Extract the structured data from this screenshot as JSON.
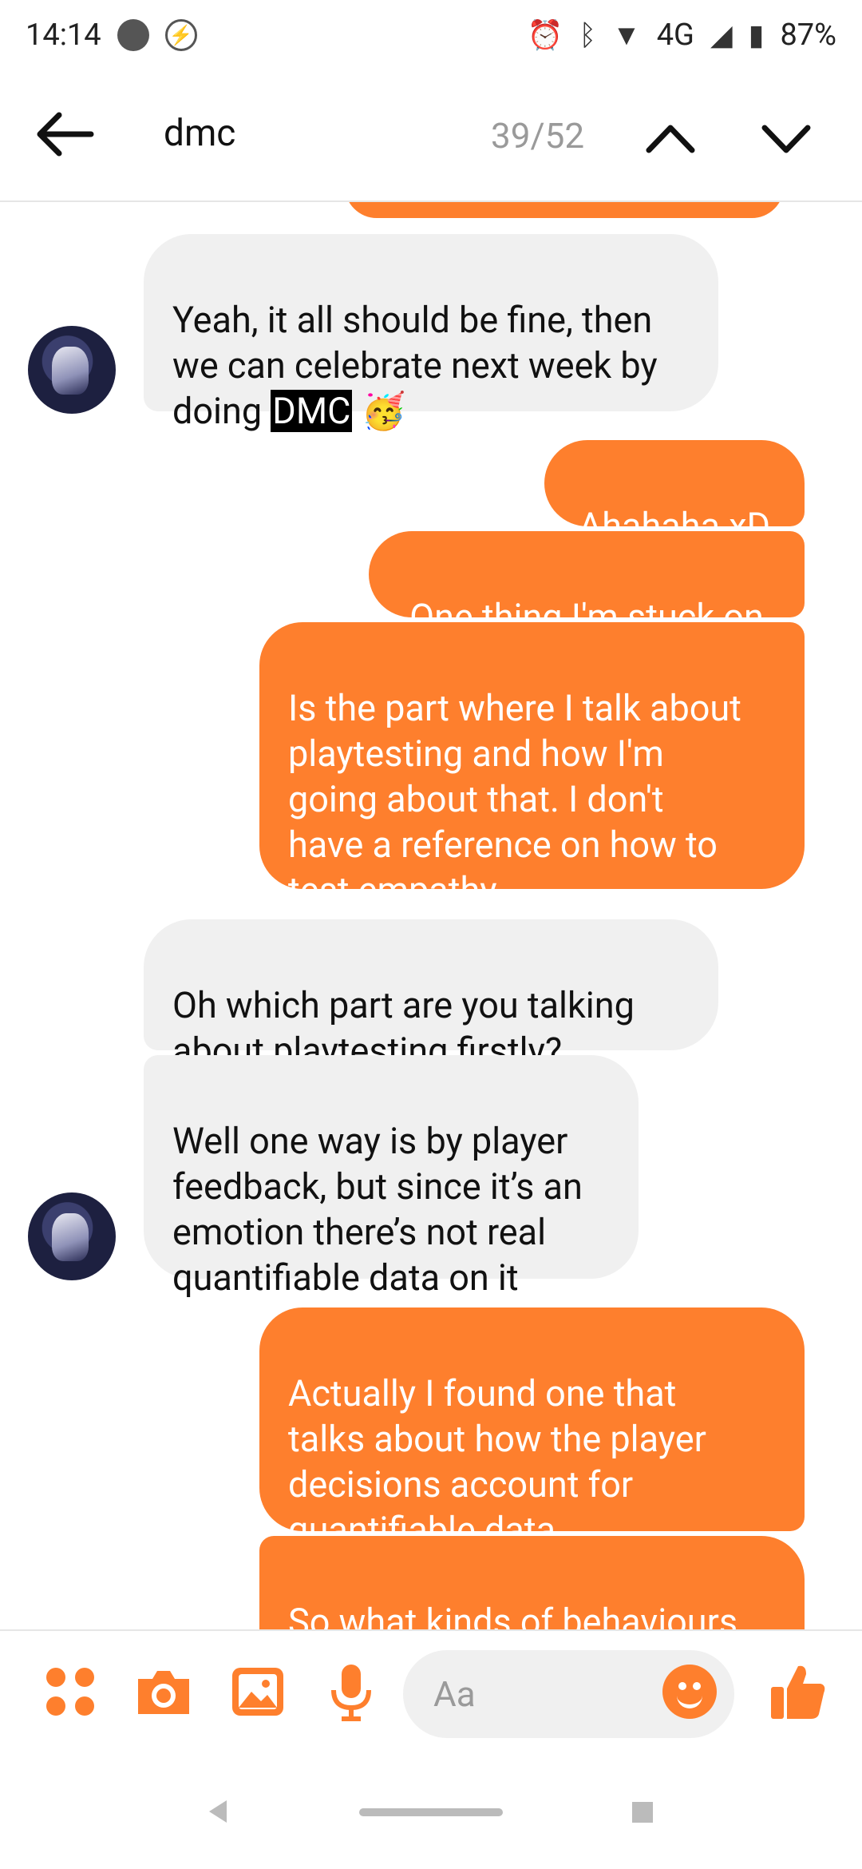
{
  "status_bar": {
    "time": "14:14",
    "network": "4G",
    "battery": "87%"
  },
  "header": {
    "search_query": "dmc",
    "match_counter": "39/52"
  },
  "messages": [
    {
      "side": "incoming",
      "text_before": "Yeah, it all should be fine, then\nwe can celebrate next week by\ndoing ",
      "highlight": "DMC",
      "emoji": "🥳"
    },
    {
      "side": "outgoing",
      "text": "Ahahaha xD"
    },
    {
      "side": "outgoing",
      "text": "One thing I'm stuck on"
    },
    {
      "side": "outgoing",
      "text": "Is the part where I talk about\nplaytesting and how I'm\ngoing about that. I don't\nhave a reference on how to\ntest empathy"
    },
    {
      "side": "incoming",
      "text": "Oh which part are you talking\nabout playtesting firstly?"
    },
    {
      "side": "incoming",
      "text": "Well one way is by player\nfeedback, but since it’s an\nemotion there’s not real\nquantifiable data on it"
    },
    {
      "side": "outgoing",
      "text": "Actually I found one that\ntalks about how the player\ndecisions account for\nquantifiable data"
    },
    {
      "side": "outgoing",
      "text": "So what kinds of behaviours\nprovoked through the"
    }
  ],
  "composer": {
    "placeholder": "Aa"
  },
  "colors": {
    "accent": "#fe7f2d",
    "incoming_bubble": "#f0f0f0"
  }
}
